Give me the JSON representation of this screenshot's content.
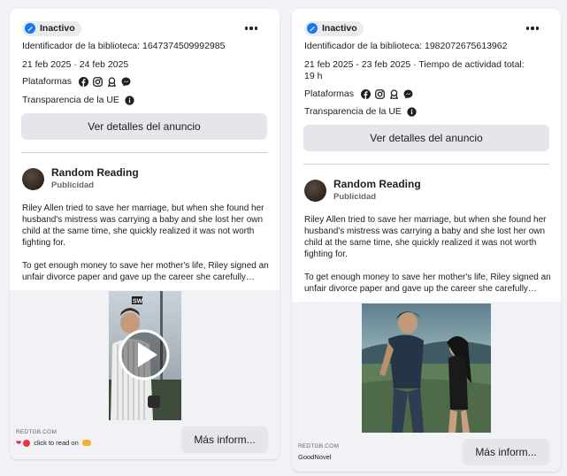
{
  "cards": [
    {
      "status": "Inactivo",
      "library_id": "Identificador de la biblioteca: 1647374509992985",
      "dates": "21 feb 2025 · 24 feb 2025",
      "platforms_label": "Plataformas",
      "eu_label": "Transparencia de la UE",
      "details_button": "Ver detalles del anuncio",
      "advertiser": "Random Reading",
      "sponsored": "Publicidad",
      "body_p1": "Riley Allen tried to save her marriage, but when she found her husband's mistress was carrying a baby and she lost her own child at the same time, she quickly realized it was not worth fighting for.",
      "body_p2": "To get enough money to save her mother's life, Riley signed an unfair divorce paper and gave up the career she carefully…",
      "footer_source": "REDTGB.COM",
      "footer_text": "click to read on",
      "cta_button": "Más inform..."
    },
    {
      "status": "Inactivo",
      "library_id": "Identificador de la biblioteca: 1982072675613962",
      "dates_line1": "21 feb 2025 - 23 feb 2025 · Tiempo de actividad total:",
      "dates_line2": "19 h",
      "platforms_label": "Plataformas",
      "eu_label": "Transparencia de la UE",
      "details_button": "Ver detalles del anuncio",
      "advertiser": "Random Reading",
      "sponsored": "Publicidad",
      "body_p1": "Riley Allen tried to save her marriage, but when she found her husband's mistress was carrying a baby and she lost her own child at the same time, she quickly realized it was not worth fighting for.",
      "body_p2": "To get enough money to save her mother's life, Riley signed an unfair divorce paper and gave up the career she carefully…",
      "footer_source": "REDTGB.COM",
      "footer_text": "GoodNovel",
      "cta_button": "Más inform..."
    }
  ],
  "icons": {
    "platforms": [
      "facebook-icon",
      "instagram-icon",
      "audience-network-icon",
      "messenger-icon"
    ],
    "info": "info-icon",
    "more": "more-options-icon",
    "play": "play-icon"
  },
  "colors": {
    "status_dot": "#1877f2",
    "button_bg": "#e4e6eb",
    "page_bg": "#f0f2f5"
  }
}
